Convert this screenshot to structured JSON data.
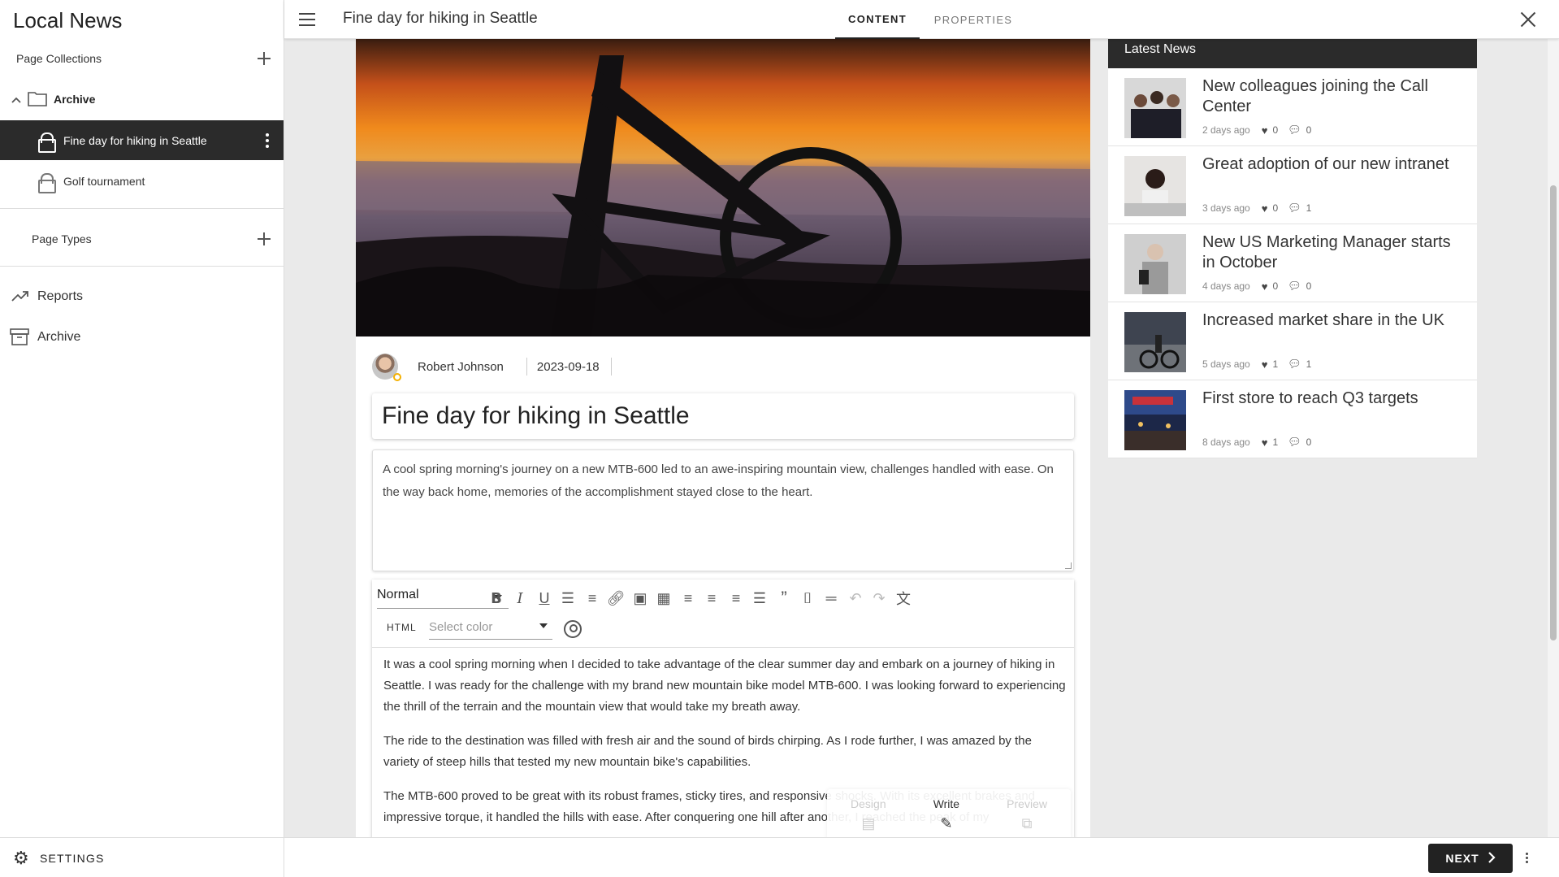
{
  "sidebar": {
    "app_title": "Local News",
    "page_collections_label": "Page Collections",
    "archive_folder_label": "Archive",
    "pages": [
      {
        "label": "Fine day for hiking in Seattle"
      },
      {
        "label": "Golf tournament"
      }
    ],
    "page_types_label": "Page Types",
    "nav": [
      {
        "label": "Reports",
        "icon": "trending-up-icon"
      },
      {
        "label": "Archive",
        "icon": "archive-box-icon"
      }
    ],
    "settings_label": "SETTINGS"
  },
  "topbar": {
    "title": "Fine day for hiking in Seattle",
    "tabs": [
      {
        "label": "CONTENT",
        "active": true
      },
      {
        "label": "PROPERTIES",
        "active": false
      }
    ]
  },
  "article": {
    "author": "Robert Johnson",
    "date": "2023-09-18",
    "title": "Fine day for hiking in Seattle",
    "summary": "A cool spring morning's journey on a new MTB-600 led to an awe-inspiring mountain view, challenges handled with ease. On the way back home, memories of the accomplishment stayed close to the heart.",
    "editor": {
      "format_value": "Normal",
      "html_label": "HTML",
      "color_placeholder": "Select color",
      "paragraphs": [
        "It was a cool spring morning when I decided to take advantage of the clear summer day and embark on a journey of hiking in Seattle. I was ready for the challenge with my brand new mountain bike model MTB-600. I was looking forward to experiencing the thrill of the terrain and the mountain view that would take my breath away.",
        "The ride to the destination was filled with fresh air and the sound of birds chirping. As I rode further, I was amazed by the variety of steep hills that tested my new mountain bike's capabilities.",
        "The MTB-600 proved to be great with its robust frames, sticky tires, and responsive shocks. With its excellent brakes and impressive torque, it handled the hills with ease. After conquering one hill after another, I reached the peak of my"
      ],
      "modes": [
        {
          "label": "Design",
          "icon": "design-icon"
        },
        {
          "label": "Write",
          "icon": "pencil-icon"
        },
        {
          "label": "Preview",
          "icon": "preview-icon"
        }
      ]
    }
  },
  "latest_news": {
    "header": "Latest News",
    "items": [
      {
        "title": "New colleagues joining the Call Center",
        "age": "2 days ago",
        "likes": "0",
        "comments": "0"
      },
      {
        "title": "Great adoption of our new intranet",
        "age": "3 days ago",
        "likes": "0",
        "comments": "1"
      },
      {
        "title": "New US Marketing Manager starts in October",
        "age": "4 days ago",
        "likes": "0",
        "comments": "0"
      },
      {
        "title": "Increased market share in the UK",
        "age": "5 days ago",
        "likes": "1",
        "comments": "1"
      },
      {
        "title": "First store to reach Q3 targets",
        "age": "8 days ago",
        "likes": "1",
        "comments": "0"
      }
    ]
  },
  "bottombar": {
    "next_label": "NEXT"
  }
}
